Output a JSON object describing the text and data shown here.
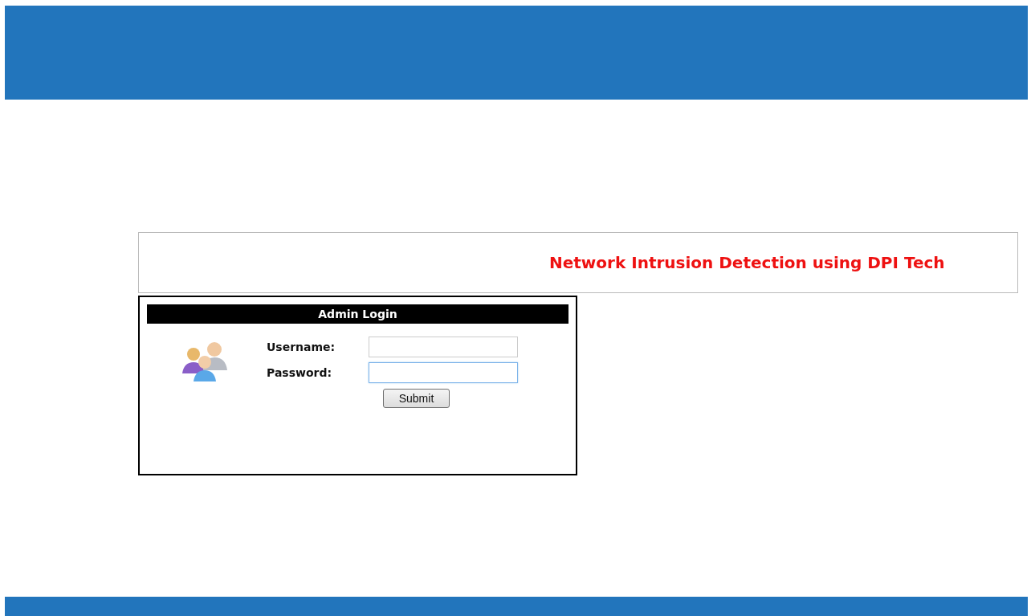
{
  "banner": {
    "title": "Network Intrusion Detection using DPI Tech"
  },
  "login": {
    "title": "Admin Login",
    "fields": [
      {
        "label": "Username:",
        "focused": false
      },
      {
        "label": "Password:",
        "focused": true
      }
    ],
    "submit": "Submit"
  }
}
